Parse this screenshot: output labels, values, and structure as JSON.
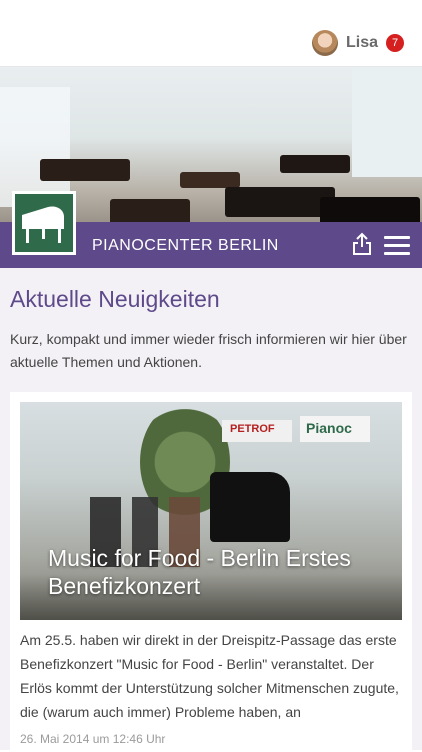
{
  "header": {
    "user": {
      "name": "Lisa",
      "notifications": "7"
    }
  },
  "brand": {
    "name": "PIANOCENTER BERLIN"
  },
  "icons": {
    "share": "share-icon",
    "menu": "hamburger-menu-icon",
    "logo": "piano-logo-icon"
  },
  "colors": {
    "brand_purple": "#5e4a8a",
    "badge_red": "#d62020",
    "logo_green": "#2f6a4a"
  },
  "main": {
    "title": "Aktuelle Neuigkeiten",
    "intro": "Kurz, kompakt und immer wieder frisch informieren wir hier über aktuelle Themen und Aktionen.",
    "articles": [
      {
        "title": "Music for Food - Berlin Erstes Benefizkonzert",
        "excerpt": "Am 25.5. haben wir direkt in der Dreispitz-Passage das erste Benefizkonzert \"Music for Food - Berlin\" veranstaltet. Der Erlös kommt der Unterstützung solcher Mitmenschen zugute, die (warum auch immer) Probleme haben, an",
        "date": "26. Mai 2014 um 12:46 Uhr",
        "image_signs": [
          "PETROF",
          "Pianoc"
        ]
      }
    ]
  }
}
